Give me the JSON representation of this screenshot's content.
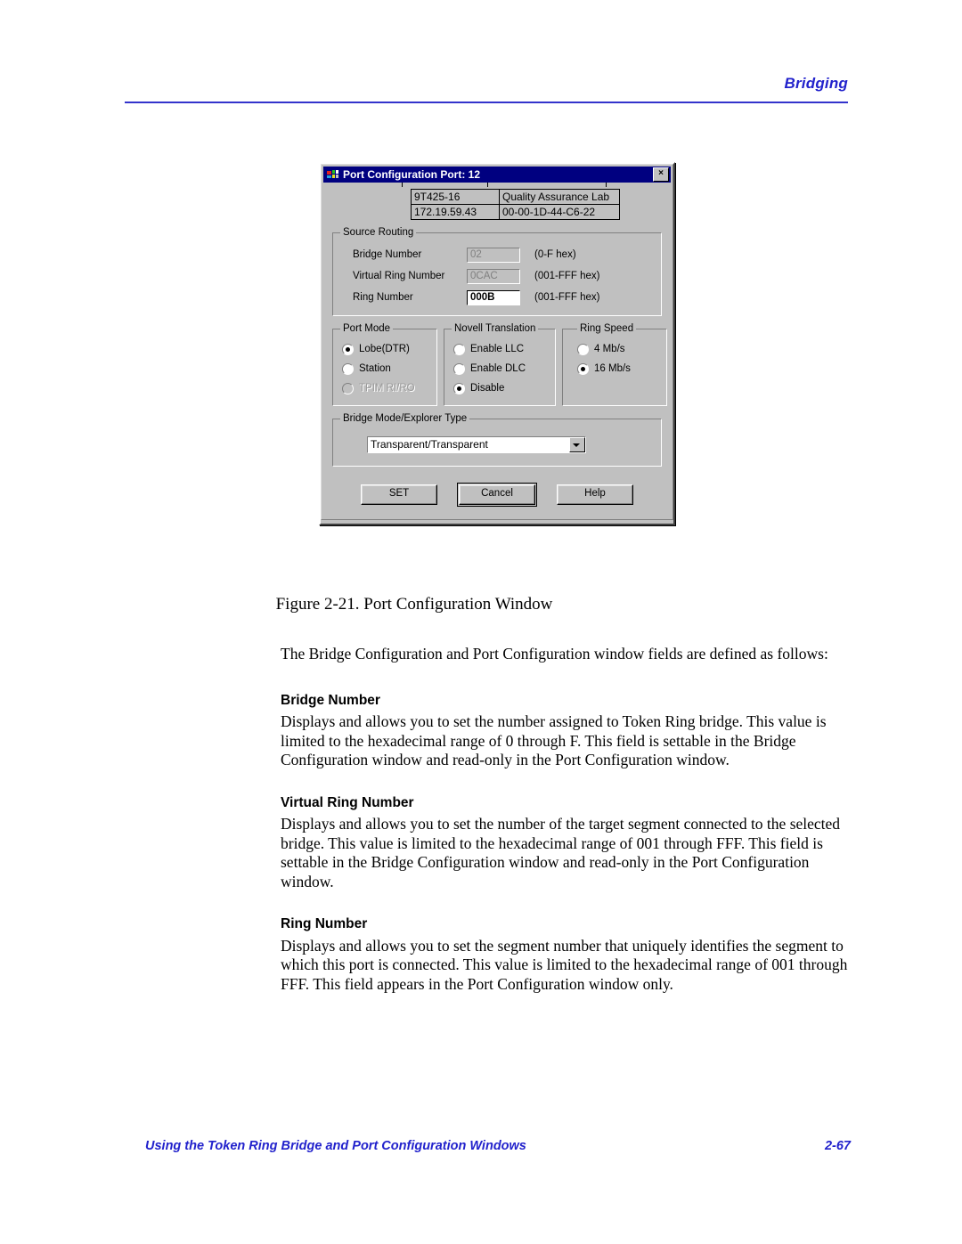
{
  "page": {
    "header_title": "Bridging",
    "footer_text": "Using the Token Ring Bridge and Port Configuration Windows",
    "page_number": "2-67",
    "header_rule_color": "#3333cc",
    "accent_color": "#2222cc"
  },
  "dialog": {
    "title": "Port Configuration Port: 12",
    "close_label": "×",
    "titlebar_color": "#000080",
    "face_color": "#c0c0c0",
    "info_table": {
      "rows": [
        [
          "9T425-16",
          "Quality Assurance Lab"
        ],
        [
          "172.19.59.43",
          "00-00-1D-44-C6-22"
        ]
      ]
    },
    "source_routing": {
      "legend": "Source Routing",
      "fields": [
        {
          "label": "Bridge Number",
          "value": "02",
          "hint": "(0-F hex)",
          "editable": false
        },
        {
          "label": "Virtual Ring Number",
          "value": "0CAC",
          "hint": "(001-FFF hex)",
          "editable": false
        },
        {
          "label": "Ring Number",
          "value": "000B",
          "hint": "(001-FFF hex)",
          "editable": true
        }
      ]
    },
    "port_mode": {
      "legend": "Port Mode",
      "options": [
        {
          "label": "Lobe(DTR)",
          "selected": true,
          "disabled": false
        },
        {
          "label": "Station",
          "selected": false,
          "disabled": false
        },
        {
          "label": "TPIM RI/RO",
          "selected": false,
          "disabled": true
        }
      ]
    },
    "novell_translation": {
      "legend": "Novell Translation",
      "options": [
        {
          "label": "Enable LLC",
          "selected": false,
          "disabled": false
        },
        {
          "label": "Enable DLC",
          "selected": false,
          "disabled": false
        },
        {
          "label": "Disable",
          "selected": true,
          "disabled": false
        }
      ]
    },
    "ring_speed": {
      "legend": "Ring Speed",
      "options": [
        {
          "label": "4 Mb/s",
          "selected": false,
          "disabled": false
        },
        {
          "label": "16 Mb/s",
          "selected": true,
          "disabled": false
        }
      ]
    },
    "bridge_mode": {
      "legend": "Bridge Mode/Explorer Type",
      "selected": "Transparent/Transparent"
    },
    "buttons": [
      {
        "label": "SET",
        "default": false
      },
      {
        "label": "Cancel",
        "default": true
      },
      {
        "label": "Help",
        "default": false
      }
    ]
  },
  "figure": {
    "caption": "Figure 2-21.  Port Configuration Window"
  },
  "content": {
    "intro": "The Bridge Configuration and Port Configuration window fields are defined as follows:",
    "sections": [
      {
        "heading": "Bridge Number",
        "text": "Displays and allows you to set the number assigned to Token Ring bridge. This value is limited to the hexadecimal range of 0 through F. This field is settable in the Bridge Configuration window and read-only in the Port Configuration window."
      },
      {
        "heading": "Virtual Ring Number",
        "text": "Displays and allows you to set the number of the target segment connected to the selected bridge. This value is limited to the hexadecimal range of 001 through FFF. This field is settable in the Bridge Configuration window and read-only in the Port Configuration window."
      },
      {
        "heading": "Ring Number",
        "text": "Displays and allows you to set the segment number that uniquely identifies the segment to which this port is connected. This value is limited to the hexadecimal range of 001 through FFF. This field appears in the Port Configuration window only."
      }
    ]
  }
}
